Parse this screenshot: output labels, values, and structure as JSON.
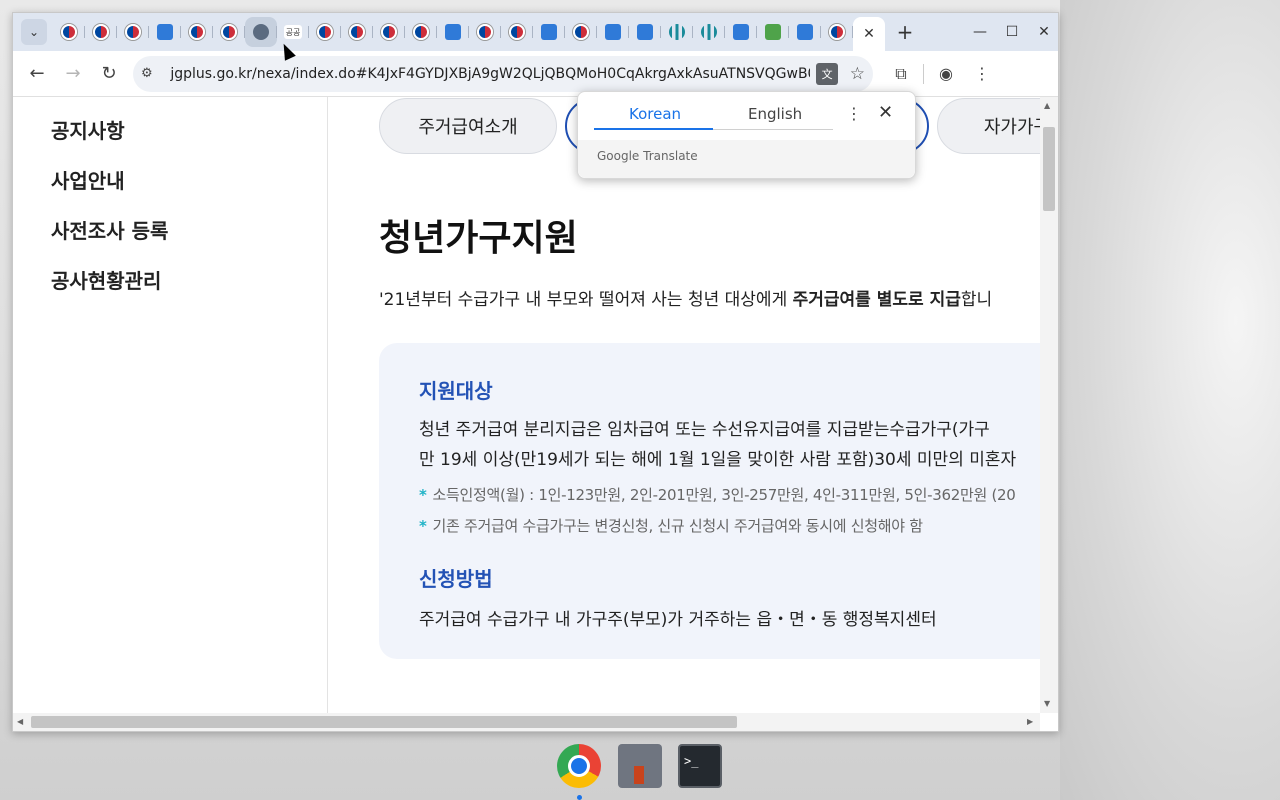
{
  "browser": {
    "tab_search_icon": "chevron-down-icon",
    "tabs": [
      {
        "favicon": "gov",
        "label": ""
      },
      {
        "favicon": "gov",
        "label": ""
      },
      {
        "favicon": "gov",
        "label": ""
      },
      {
        "favicon": "lh",
        "label": ""
      },
      {
        "favicon": "gov",
        "label": ""
      },
      {
        "favicon": "gov",
        "label": ""
      },
      {
        "favicon": "globe",
        "label": ""
      },
      {
        "favicon": "txt",
        "label": "공공"
      },
      {
        "favicon": "gov",
        "label": ""
      },
      {
        "favicon": "gov",
        "label": ""
      },
      {
        "favicon": "gov",
        "label": ""
      },
      {
        "favicon": "gov",
        "label": ""
      },
      {
        "favicon": "lh",
        "label": ""
      },
      {
        "favicon": "gov",
        "label": ""
      },
      {
        "favicon": "gov",
        "label": ""
      },
      {
        "favicon": "lh",
        "label": ""
      },
      {
        "favicon": "gov",
        "label": ""
      },
      {
        "favicon": "lh",
        "label": ""
      },
      {
        "favicon": "lh",
        "label": ""
      },
      {
        "favicon": "bars",
        "label": ""
      },
      {
        "favicon": "bars",
        "label": ""
      },
      {
        "favicon": "lh",
        "label": ""
      },
      {
        "favicon": "lhlogo",
        "label": ""
      },
      {
        "favicon": "lh",
        "label": ""
      },
      {
        "favicon": "gov",
        "label": ""
      }
    ],
    "new_tab_label": "+",
    "url": "jgplus.go.kr/nexa/index.do#K4JxF4GYDJXBjA9gW2QLjQBQMoH0CqAkrgAxkAsuATNSVQGwB0..."
  },
  "sidebar": {
    "items": [
      {
        "label": "공지사항"
      },
      {
        "label": "사업안내"
      },
      {
        "label": "사전조사 등록"
      },
      {
        "label": "공사현황관리"
      }
    ]
  },
  "main": {
    "pills": [
      {
        "label": "주거급여소개"
      },
      {
        "label": ""
      },
      {
        "label": "자가가구"
      }
    ],
    "title": "청년가구지원",
    "intro_prefix": "'21년부터 수급가구 내 부모와 떨어져 사는 청년 대상에게 ",
    "intro_bold": "주거급여를 별도로 지급",
    "intro_suffix": "합니",
    "section1_title": "지원대상",
    "section1_line1": "청년 주거급여 분리지급은 임차급여 또는 수선유지급여를 지급받는수급가구(가구",
    "section1_line2": "만 19세 이상(만19세가 되는 해에 1월 1일을 맞이한 사람 포함)30세 미만의 미혼자",
    "bullet1": "소득인정액(월) : 1인-123만원, 2인-201만원, 3인-257만원, 4인-311만원, 5인-362만원 (20",
    "bullet2": "기존 주거급여 수급가구는 변경신청, 신규 신청시 주거급여와 동시에 신청해야 함",
    "bullet_marker": "*",
    "section2_title": "신청방법",
    "section2_line1": "주거급여 수급가구 내 가구주(부모)가 거주하는 읍・면・동 행정복지센터"
  },
  "translate_popup": {
    "tab_korean": "Korean",
    "tab_english": "English",
    "brand_google": "Google",
    "brand_translate": " Translate",
    "accent_color": "#1a73e8"
  },
  "taskbar": {
    "apps": [
      "chrome",
      "network-manager",
      "terminal"
    ],
    "terminal_glyph": ">_"
  }
}
